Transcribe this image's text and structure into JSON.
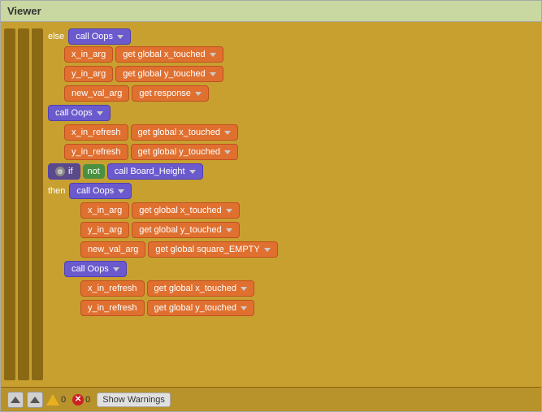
{
  "window": {
    "title": "Viewer"
  },
  "blocks": {
    "else_label": "else",
    "then_label": "then",
    "call_label": "call",
    "if_label": "if",
    "not_label": "not",
    "get_label": "get",
    "x_in_arg": "x_in_arg",
    "y_in_arg": "y_in_arg",
    "new_val_arg": "new_val_arg",
    "x_in_refresh": "x_in_refresh",
    "y_in_refresh": "y_in_refresh",
    "oops": "Oops",
    "board_height": "Board_Height",
    "global_x_touched": "global x_touched",
    "global_y_touched": "global y_touched",
    "response": "response",
    "global_square_empty": "global square_EMPTY"
  },
  "toolbar": {
    "warning_count": "0",
    "error_count": "0",
    "show_warnings_label": "Show Warnings"
  }
}
